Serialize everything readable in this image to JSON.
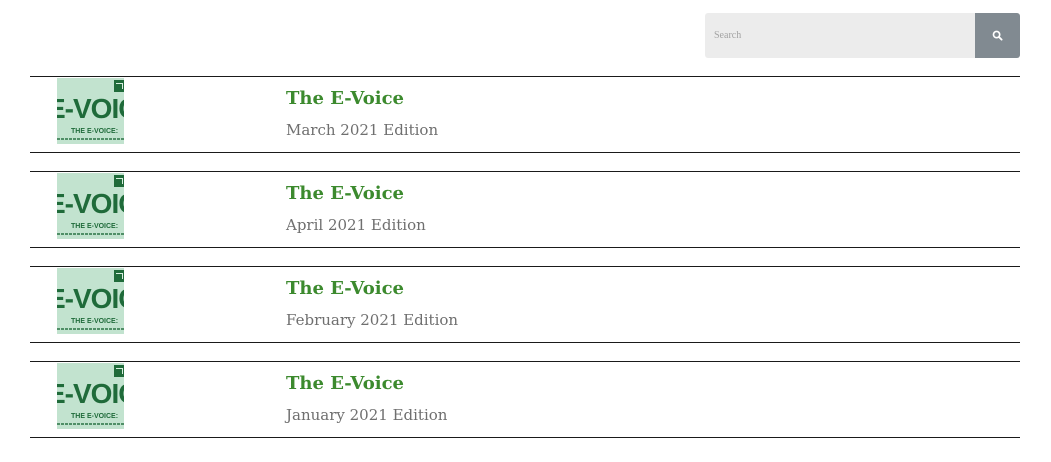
{
  "search": {
    "placeholder": "Search",
    "button_icon": "search-icon"
  },
  "newsletters": [
    {
      "title": "The E-Voice",
      "edition": "March 2021 Edition",
      "thumb_big": "E-VOICE",
      "thumb_small": "THE E-VOICE:"
    },
    {
      "title": "The E-Voice",
      "edition": "April 2021 Edition",
      "thumb_big": "E-VOICE",
      "thumb_small": "THE E-VOICE:"
    },
    {
      "title": "The E-Voice",
      "edition": "February 2021 Edition",
      "thumb_big": "E-VOICE",
      "thumb_small": "THE E-VOICE:"
    },
    {
      "title": "The E-Voice",
      "edition": "January 2021 Edition",
      "thumb_big": "E-VOICE",
      "thumb_small": "THE E-VOICE:"
    }
  ],
  "colors": {
    "title_green": "#3c8a2e",
    "thumb_bg": "#c2e3cf",
    "thumb_green": "#1f6b3a",
    "search_button": "#818a91"
  }
}
